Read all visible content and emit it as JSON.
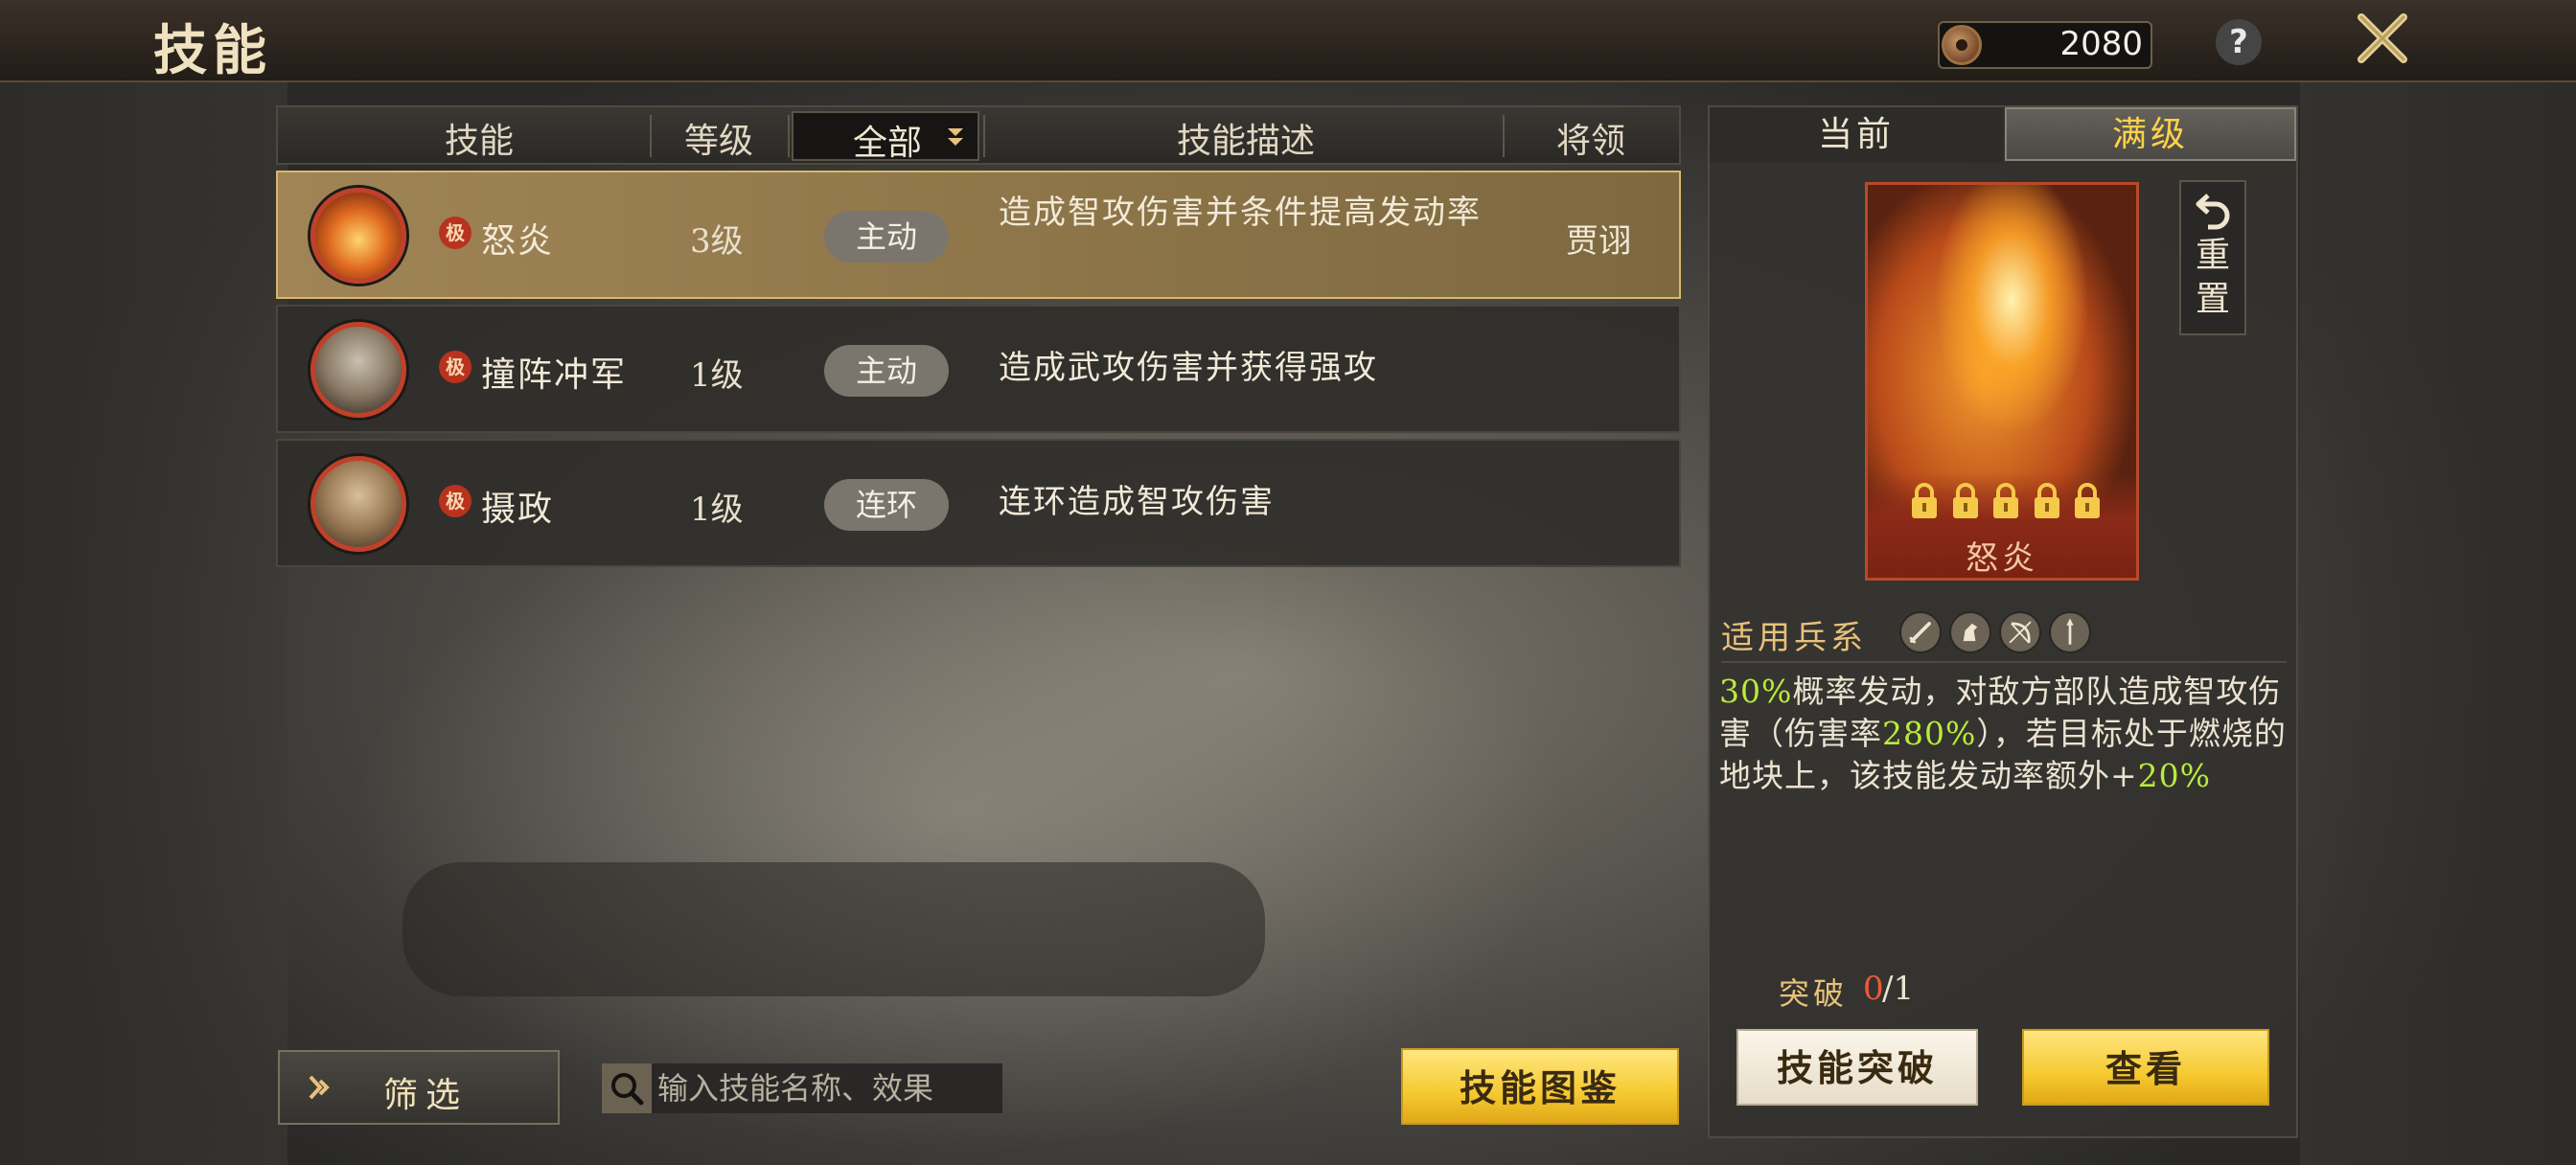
{
  "header": {
    "title": "技能",
    "currency_value": "2080",
    "help_symbol": "?"
  },
  "table": {
    "columns": {
      "skill": "技能",
      "level": "等级",
      "filter_selected": "全部",
      "description": "技能描述",
      "general": "将领"
    },
    "rows": [
      {
        "rank": "极",
        "name": "怒炎",
        "level": "3级",
        "type": "主动",
        "description": "造成智攻伤害并条件提高发动率",
        "general": "贾诩",
        "selected": true
      },
      {
        "rank": "极",
        "name": "撞阵冲军",
        "level": "1级",
        "type": "主动",
        "description": "造成武攻伤害并获得强攻",
        "general": "",
        "selected": false
      },
      {
        "rank": "极",
        "name": "摄政",
        "level": "1级",
        "type": "连环",
        "description": "连环造成智攻伤害",
        "general": "",
        "selected": false
      }
    ]
  },
  "bottom": {
    "filter_label": "筛选",
    "search_placeholder": "输入技能名称、效果",
    "catalog_label": "技能图鉴"
  },
  "detail": {
    "tab_current": "当前",
    "tab_max": "满级",
    "reset_label": "重置",
    "card_name": "怒炎",
    "locks_count": 5,
    "troop_label": "适用兵系",
    "troop_icons": [
      "sword-icon",
      "horse-icon",
      "bow-icon",
      "spear-icon"
    ],
    "effect": {
      "p1_hl": "30%",
      "p2": "概率发动，对敌方部队造成智攻伤害（伤害率",
      "p3_hl": "280%",
      "p4": "），若目标处于燃烧的地块上，该技能发动率额外+",
      "p5_hl": "20%"
    },
    "breakthrough_label": "突破",
    "breakthrough_current": "0",
    "breakthrough_max": "/1",
    "breakthrough_button": "技能突破",
    "view_button": "查看"
  },
  "colors": {
    "accent_yellow": "#f5c92f",
    "highlight_green": "#b8ec3a",
    "rank_red": "#b8321e",
    "tab_max_text": "#ffd34a"
  }
}
